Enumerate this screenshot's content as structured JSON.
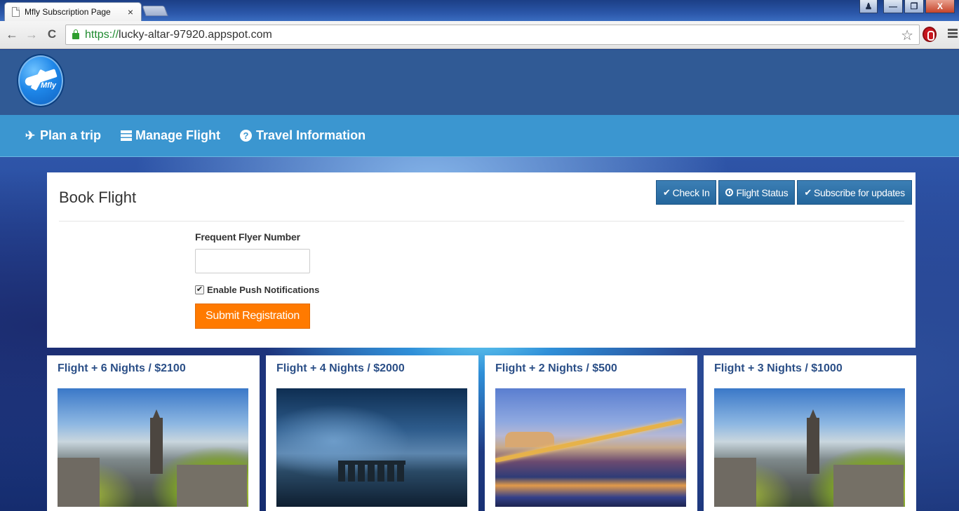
{
  "browser": {
    "tab_title": "Mfly Subscription Page",
    "tab_close": "×",
    "url_protocol": "https://",
    "url_host": "lucky-altar-97920.appspot.com",
    "back": "←",
    "forward": "→",
    "reload": "C",
    "window_buttons": {
      "minimize": "—",
      "restore": "❐",
      "close": "X"
    }
  },
  "site": {
    "logo_text": "Mfly",
    "nav": [
      {
        "label": "Plan a trip",
        "icon": "plane-icon"
      },
      {
        "label": "Manage Flight",
        "icon": "server-icon"
      },
      {
        "label": "Travel Information",
        "icon": "question-circle-icon"
      }
    ]
  },
  "booking": {
    "title": "Book Flight",
    "actions": [
      {
        "label": "Check In",
        "icon": "check-icon"
      },
      {
        "label": "Flight Status",
        "icon": "clock-icon"
      },
      {
        "label": "Subscribe for updates",
        "icon": "check-icon"
      }
    ],
    "frequent_flyer_label": "Frequent Flyer Number",
    "frequent_flyer_value": "",
    "push_label": "Enable Push Notifications",
    "push_checked": true,
    "submit_label": "Submit Registration"
  },
  "deals": [
    {
      "title": "Flight + 6 Nights / $2100",
      "image": "edinburgh"
    },
    {
      "title": "Flight + 4 Nights / $2000",
      "image": "stonehenge"
    },
    {
      "title": "Flight + 2 Nights / $500",
      "image": "budapest"
    },
    {
      "title": "Flight + 3 Nights / $1000",
      "image": "edinburgh"
    }
  ],
  "colors": {
    "header": "#305a95",
    "navbar": "#3b96d0",
    "action_button": "#2e73aa",
    "submit_button": "#ff7a00",
    "deal_title": "#2b4f87"
  }
}
